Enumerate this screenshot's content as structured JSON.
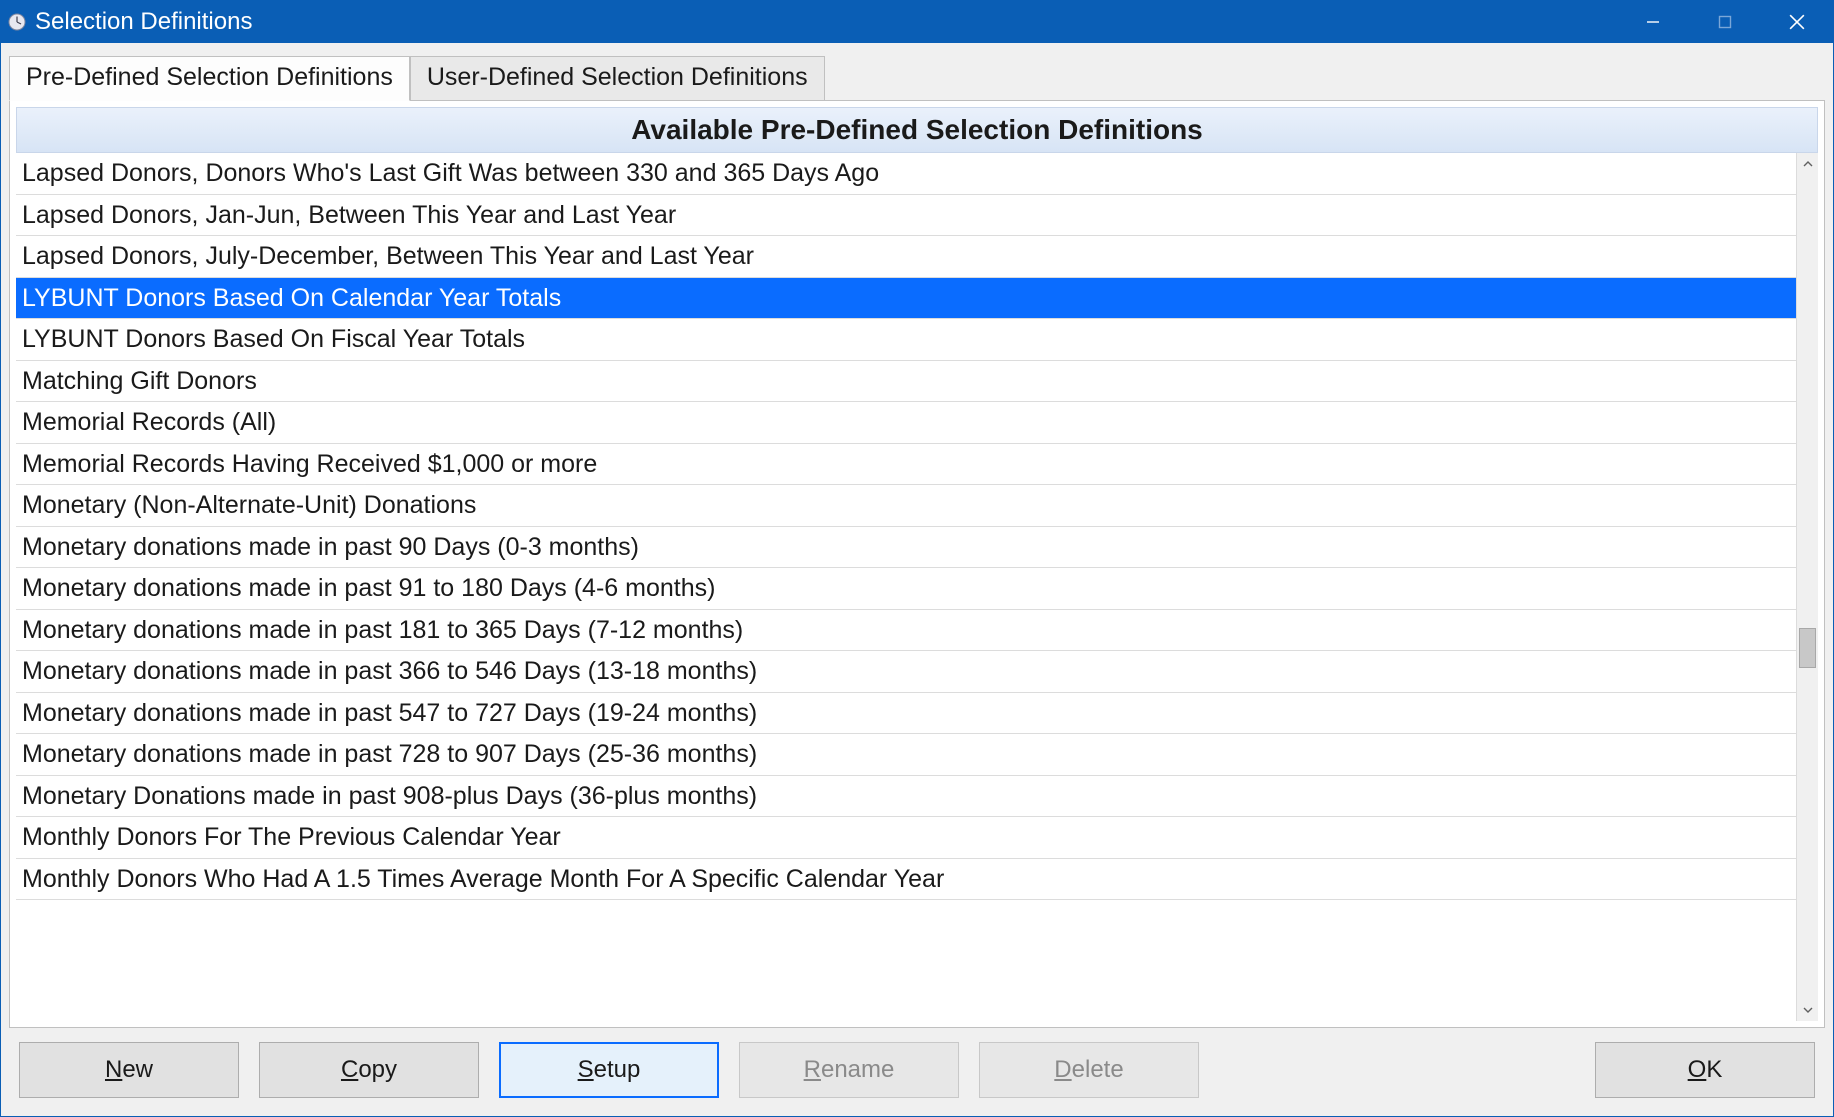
{
  "window": {
    "title": "Selection Definitions"
  },
  "tabs": {
    "predefined": "Pre-Defined Selection Definitions",
    "userdefined": "User-Defined Selection Definitions"
  },
  "panel": {
    "header": "Available Pre-Defined Selection Definitions"
  },
  "definitions": [
    "Lapsed Donors, Donors Who's Last Gift Was between 330 and 365 Days Ago",
    "Lapsed Donors, Jan-Jun, Between This Year and Last Year",
    "Lapsed Donors, July-December, Between This Year and Last Year",
    "LYBUNT Donors Based On Calendar Year Totals",
    "LYBUNT Donors Based On Fiscal Year Totals",
    "Matching Gift Donors",
    "Memorial Records (All)",
    "Memorial Records Having Received $1,000 or more",
    "Monetary (Non-Alternate-Unit) Donations",
    "Monetary donations made in past  90 Days (0-3 months)",
    "Monetary donations made in past  91 to 180 Days (4-6 months)",
    "Monetary donations made in past 181 to 365 Days (7-12 months)",
    "Monetary donations made in past 366 to 546 Days (13-18 months)",
    "Monetary donations made in past 547 to 727 Days (19-24 months)",
    "Monetary donations made in past 728 to 907 Days (25-36 months)",
    "Monetary Donations made in past 908-plus Days (36-plus months)",
    "Monthly Donors For The Previous Calendar Year",
    "Monthly Donors Who Had A 1.5 Times Average Month For A Specific Calendar Year"
  ],
  "selected_index": 3,
  "buttons": {
    "new": {
      "pre": "",
      "u": "N",
      "post": "ew",
      "enabled": true
    },
    "copy": {
      "pre": "",
      "u": "C",
      "post": "opy",
      "enabled": true
    },
    "setup": {
      "pre": "",
      "u": "S",
      "post": "etup",
      "enabled": true,
      "focused": true
    },
    "rename": {
      "pre": "",
      "u": "R",
      "post": "ename",
      "enabled": false
    },
    "delete": {
      "pre": "",
      "u": "D",
      "post": "elete",
      "enabled": false
    },
    "ok": {
      "pre": "",
      "u": "O",
      "post": "K",
      "enabled": true
    }
  }
}
